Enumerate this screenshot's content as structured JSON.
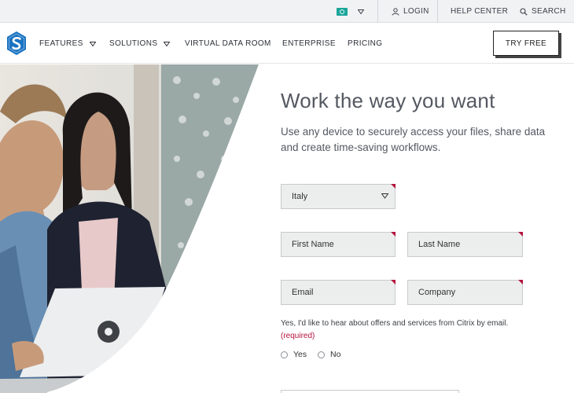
{
  "utility_bar": {
    "region_icon": "globe-flag-icon",
    "login": "LOGIN",
    "help_center": "HELP CENTER",
    "search": "SEARCH"
  },
  "nav": {
    "logo": "sharefile-logo",
    "items": [
      {
        "label": "FEATURES",
        "has_dropdown": true
      },
      {
        "label": "SOLUTIONS",
        "has_dropdown": true
      },
      {
        "label": "VIRTUAL DATA ROOM",
        "has_dropdown": false
      },
      {
        "label": "ENTERPRISE",
        "has_dropdown": false
      },
      {
        "label": "PRICING",
        "has_dropdown": false
      }
    ],
    "cta": "TRY FREE"
  },
  "hero": {
    "headline": "Work the way you want",
    "subhead": "Use any device to securely access your files, share data and create time-saving workflows."
  },
  "form": {
    "country": {
      "value": "Italy"
    },
    "first_name": {
      "placeholder": "First Name"
    },
    "last_name": {
      "placeholder": "Last Name"
    },
    "email": {
      "placeholder": "Email"
    },
    "company": {
      "placeholder": "Company"
    },
    "consent_text": "Yes, I'd like to hear about offers and services from Citrix by email.",
    "required_note": "(required)",
    "options": {
      "yes": "Yes",
      "no": "No"
    }
  },
  "colors": {
    "accent": "#1a73c2",
    "required": "#b4143c",
    "field_bg": "#eceded"
  }
}
